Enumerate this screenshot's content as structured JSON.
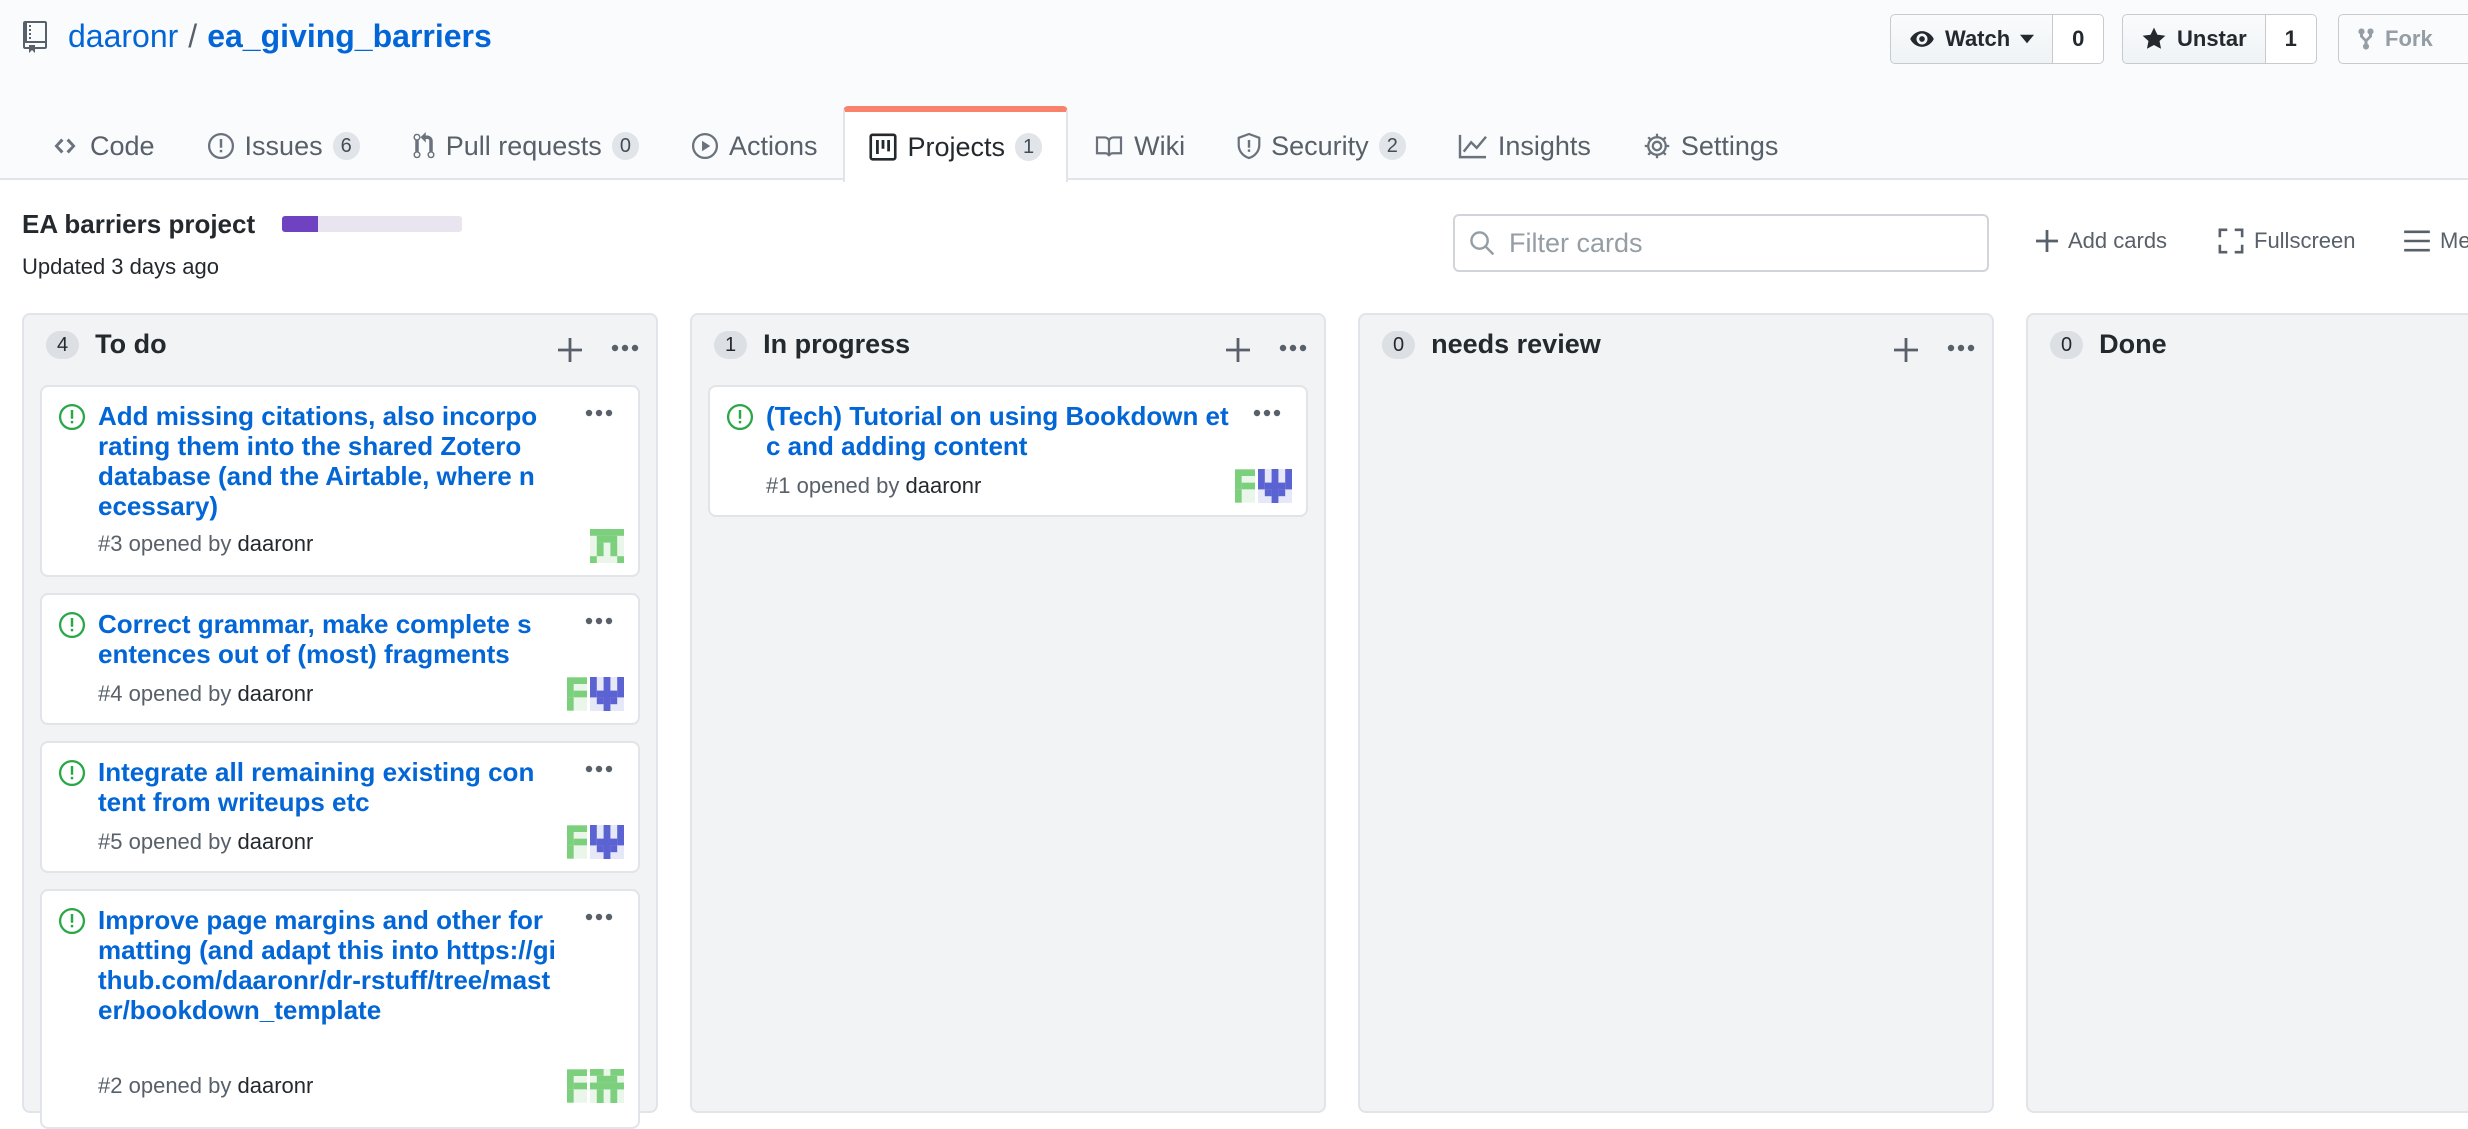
{
  "repo": {
    "owner": "daaronr",
    "separator": "/",
    "name": "ea_giving_barriers"
  },
  "actions": {
    "watch_label": "Watch",
    "watch_count": "0",
    "star_label": "Unstar",
    "star_count": "1",
    "fork_label": "Fork"
  },
  "tabs": [
    {
      "label": "Code",
      "icon": "code-icon"
    },
    {
      "label": "Issues",
      "count": "6",
      "icon": "issue-icon"
    },
    {
      "label": "Pull requests",
      "count": "0",
      "icon": "pull-request-icon"
    },
    {
      "label": "Actions",
      "icon": "play-icon"
    },
    {
      "label": "Projects",
      "count": "1",
      "icon": "project-icon",
      "selected": true
    },
    {
      "label": "Wiki",
      "icon": "book-icon"
    },
    {
      "label": "Security",
      "count": "2",
      "icon": "shield-icon"
    },
    {
      "label": "Insights",
      "icon": "graph-icon"
    },
    {
      "label": "Settings",
      "icon": "gear-icon"
    }
  ],
  "project": {
    "name": "EA barriers project",
    "updated": "Updated 3 days ago",
    "progress_fraction": 0.2,
    "filter_placeholder": "Filter cards",
    "add_cards_label": "Add cards",
    "fullscreen_label": "Fullscreen",
    "menu_label": "Menu"
  },
  "columns": [
    {
      "count": "4",
      "name": "To do",
      "cards": [
        {
          "title": "Add missing citations, also incorporating them into the shared Zotero database (and the Airtable, where necessary)",
          "number": "#3",
          "opened_by": "opened by",
          "user": "daaronr"
        },
        {
          "title": "Correct grammar, make complete sentences out of (most) fragments",
          "number": "#4",
          "opened_by": "opened by",
          "user": "daaronr"
        },
        {
          "title": "Integrate all remaining existing content from writeups etc",
          "number": "#5",
          "opened_by": "opened by",
          "user": "daaronr"
        },
        {
          "title": "Improve page margins and other formatting (and adapt this into https://github.com/daaronr/dr-rstuff/tree/master/bookdown_template",
          "number": "#2",
          "opened_by": "opened by",
          "user": "daaronr"
        }
      ]
    },
    {
      "count": "1",
      "name": "In progress",
      "cards": [
        {
          "title": "(Tech) Tutorial on using Bookdown etc and adding content",
          "number": "#1",
          "opened_by": "opened by",
          "user": "daaronr"
        }
      ]
    },
    {
      "count": "0",
      "name": "needs review",
      "cards": []
    },
    {
      "count": "0",
      "name": "Done",
      "cards": []
    }
  ],
  "colors": {
    "link": "#0366d6",
    "open_issue": "#28a745",
    "progress": "#6f42c1",
    "tab_accent": "#f9826c"
  }
}
